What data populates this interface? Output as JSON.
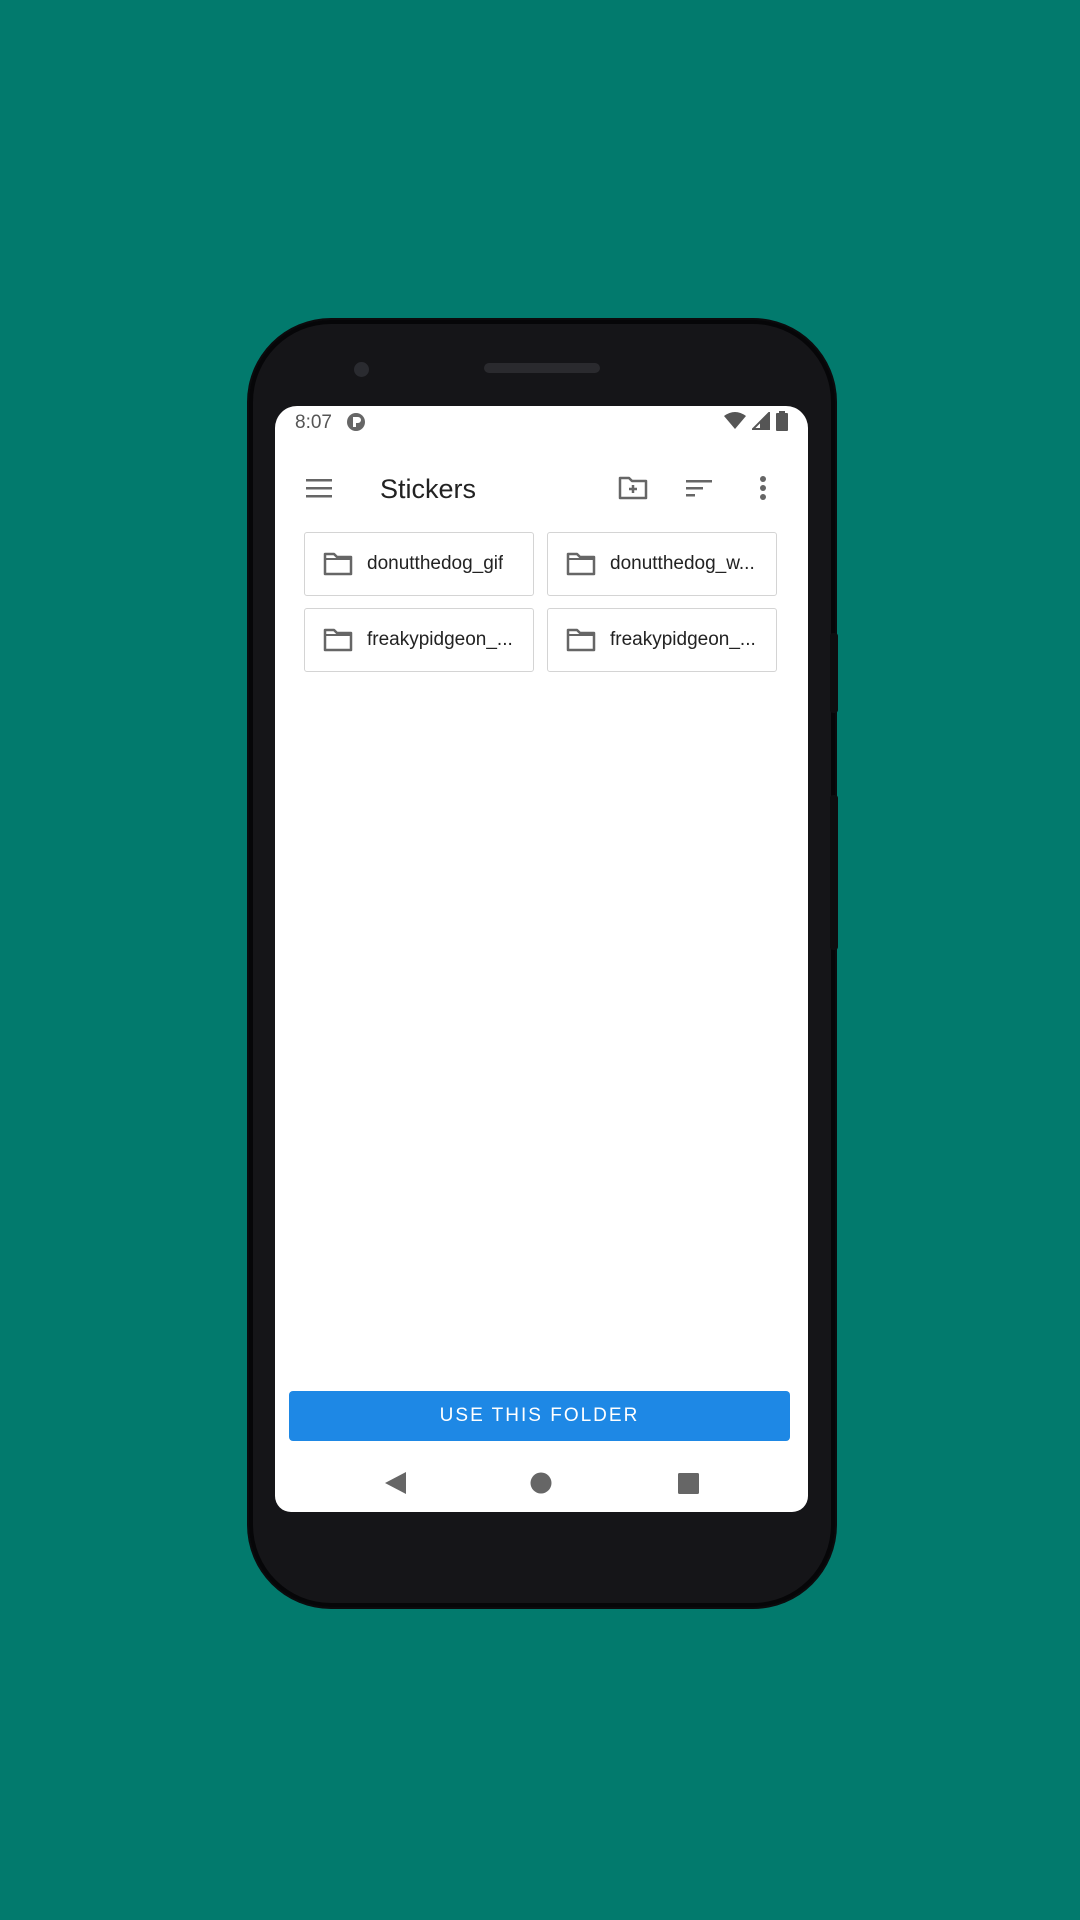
{
  "status_bar": {
    "time": "8:07"
  },
  "app_bar": {
    "title": "Stickers",
    "icons": [
      "menu-icon",
      "new-folder-icon",
      "sort-icon",
      "more-vert-icon"
    ]
  },
  "folders": [
    {
      "name": "donutthedog_gif"
    },
    {
      "name": "donutthedog_w..."
    },
    {
      "name": "freakypidgeon_..."
    },
    {
      "name": "freakypidgeon_..."
    }
  ],
  "action": {
    "use_folder_label": "USE THIS FOLDER"
  },
  "colors": {
    "background": "#027a6d",
    "accent": "#1e88e5"
  }
}
